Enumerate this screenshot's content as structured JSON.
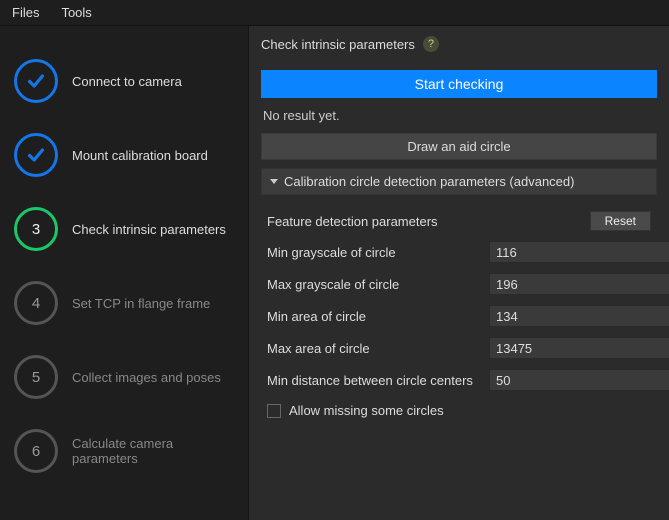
{
  "menubar": {
    "files": "Files",
    "tools": "Tools"
  },
  "sidebar": {
    "steps": [
      {
        "label": "Connect to camera"
      },
      {
        "label": "Mount calibration board"
      },
      {
        "label": "Check intrinsic parameters",
        "num": "3"
      },
      {
        "label": "Set TCP in flange frame",
        "num": "4"
      },
      {
        "label": "Collect images and poses",
        "num": "5"
      },
      {
        "label": "Calculate camera parameters",
        "num": "6"
      }
    ]
  },
  "main": {
    "title": "Check intrinsic parameters",
    "help": "?",
    "start_btn": "Start checking",
    "status": "No result yet.",
    "aid_btn": "Draw an aid circle",
    "collapsible": "Calibration circle detection parameters (advanced)",
    "section_title": "Feature detection parameters",
    "reset_btn": "Reset",
    "params": [
      {
        "label": "Min grayscale of circle",
        "value": "116"
      },
      {
        "label": "Max grayscale of circle",
        "value": "196"
      },
      {
        "label": "Min area of circle",
        "value": "134"
      },
      {
        "label": "Max area of circle",
        "value": "13475"
      },
      {
        "label": "Min distance between circle centers",
        "value": "50"
      }
    ],
    "checkbox_label": "Allow missing some circles"
  }
}
